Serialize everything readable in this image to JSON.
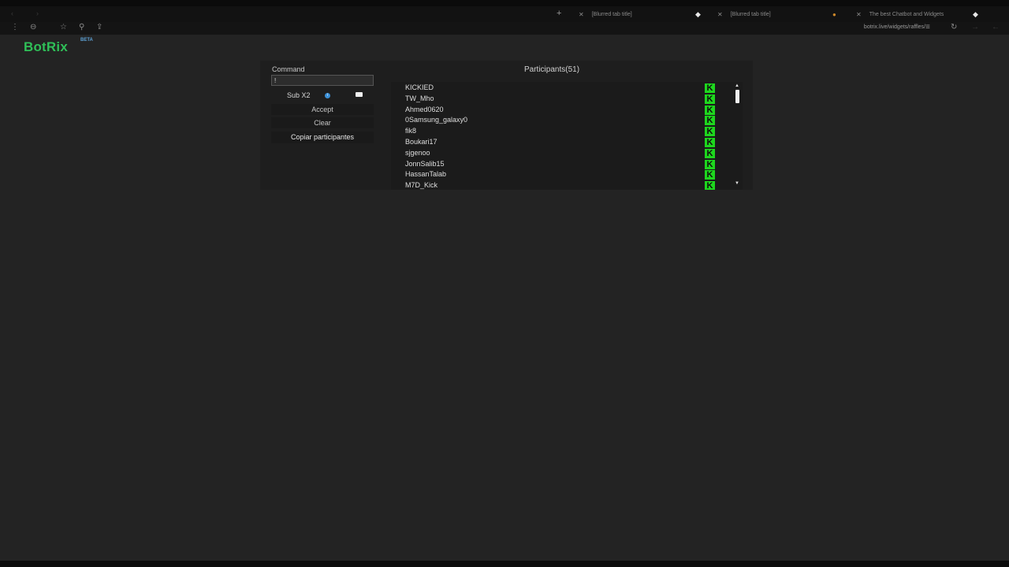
{
  "browser": {
    "tabs": [
      {
        "title": "[Blurred tab title]"
      },
      {
        "title": "[Blurred tab title]"
      },
      {
        "title": "The best Chatbot and Widgets"
      }
    ],
    "url": "botrix.live/widgets/raffles/"
  },
  "app": {
    "logo": "BotRix",
    "beta_label": "BETA"
  },
  "controls": {
    "command_label": "Command",
    "command_value": "!",
    "sub_label": "Sub X2",
    "accept_label": "Accept",
    "clear_label": "Clear",
    "copy_label": "Copiar participantes"
  },
  "participants": {
    "title": "Participants(51)",
    "icon_color": "#1ed61e",
    "items": [
      {
        "name": "KICKIED"
      },
      {
        "name": "TW_Mho"
      },
      {
        "name": "Ahmed0620"
      },
      {
        "name": "0Samsung_galaxy0"
      },
      {
        "name": "fik8"
      },
      {
        "name": "Boukari17"
      },
      {
        "name": "sjgenoo"
      },
      {
        "name": "JonnSalib15"
      },
      {
        "name": "HassanTalab"
      },
      {
        "name": "M7D_Kick"
      }
    ]
  },
  "colors": {
    "brand": "#2fbf58",
    "beta": "#5ea2d6",
    "page_bg": "#232323"
  }
}
